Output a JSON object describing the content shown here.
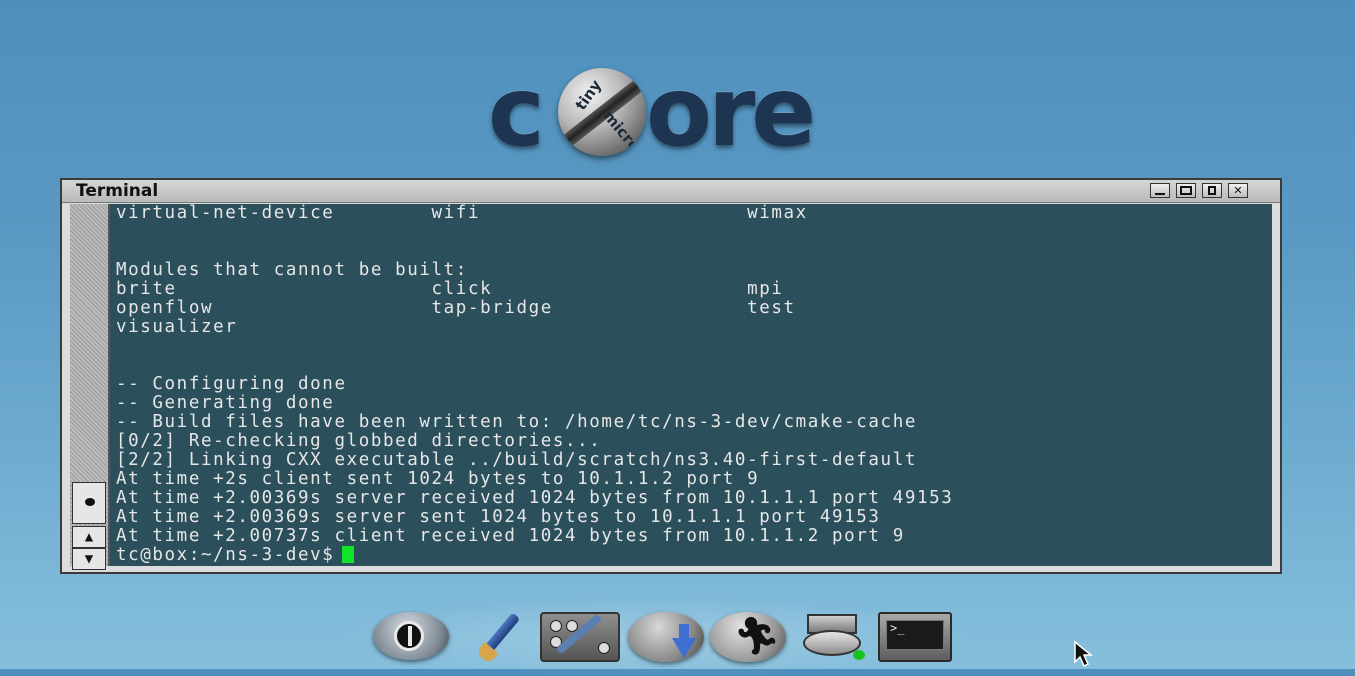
{
  "logo": {
    "left_text": "c",
    "right_text": "ore",
    "ball_top": "tiny",
    "ball_bottom": "micro"
  },
  "window": {
    "title": "Terminal",
    "buttons": [
      "minimize",
      "maximize",
      "restore",
      "close"
    ]
  },
  "terminal": {
    "lines": [
      "virtual-net-device        wifi                      wimax",
      "",
      "",
      "Modules that cannot be built:",
      "brite                     click                     mpi",
      "openflow                  tap-bridge                test",
      "visualizer",
      "",
      "",
      "-- Configuring done",
      "-- Generating done",
      "-- Build files have been written to: /home/tc/ns-3-dev/cmake-cache",
      "[0/2] Re-checking globbed directories...",
      "[2/2] Linking CXX executable ../build/scratch/ns3.40-first-default",
      "At time +2s client sent 1024 bytes to 10.1.1.2 port 9",
      "At time +2.00369s server received 1024 bytes from 10.1.1.1 port 49153",
      "At time +2.00369s server sent 1024 bytes to 10.1.1.1 port 49153",
      "At time +2.00737s client received 1024 bytes from 10.1.1.2 port 9"
    ],
    "prompt": "tc@box:~/ns-3-dev$",
    "cursor_color": "#11e22a",
    "background_color": "#2c4f5c"
  },
  "dock": {
    "items": [
      "power-icon",
      "paintbrush-icon",
      "control-panel-icon",
      "app-install-icon",
      "run-icon",
      "backup-icon",
      "terminal-icon"
    ],
    "terminal_icon_text": ">_"
  },
  "scrollbar": {
    "up_arrow": "▲",
    "down_arrow": "▼"
  }
}
